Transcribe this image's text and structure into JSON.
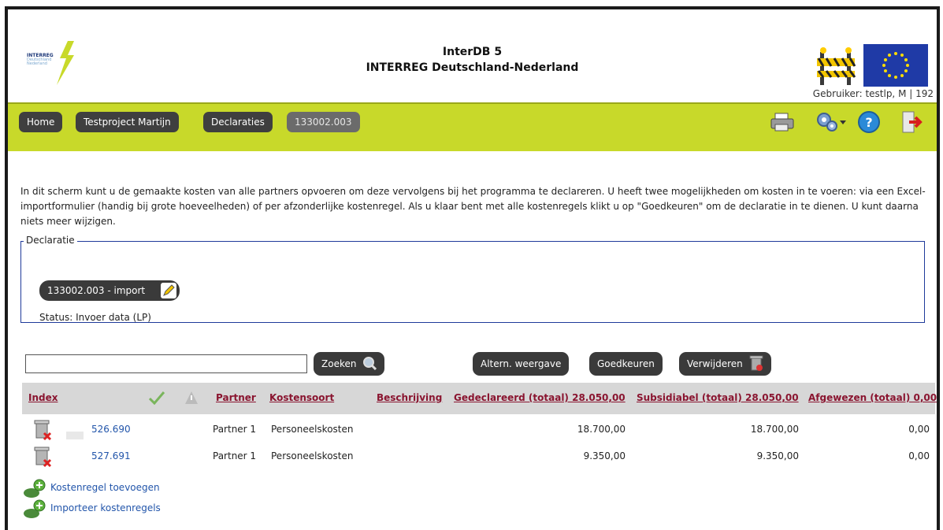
{
  "header": {
    "logo_text": "INTERREG",
    "logo_sub": "Deutschland Nederland",
    "title_line1": "InterDB 5",
    "title_line2": "INTERREG Deutschland-Nederland",
    "user": "Gebruiker: testlp, M | 192"
  },
  "nav": {
    "crumbs": [
      "Home",
      "Testproject Martijn",
      "Declaraties",
      "133002.003"
    ],
    "icons": [
      "print-icon",
      "settings-icon",
      "help-icon",
      "logout-icon"
    ]
  },
  "intro": "In dit scherm kunt u de gemaakte kosten van alle partners opvoeren om deze vervolgens bij het programma te declareren. U heeft twee mogelijkheden om kosten in te voeren: via een Excel-importformulier (handig bij grote hoeveelheden) of per afzonderlijke kostenregel. Als u klaar bent met alle kostenregels klikt u op \"Goedkeuren\" om de declaratie in te dienen. U kunt daarna niets meer wijzigen.",
  "declaratie": {
    "legend": "Declaratie",
    "pill": "133002.003 - import",
    "status": "Status:  Invoer data (LP)"
  },
  "toolbar": {
    "search_value": "",
    "search_label": "Zoeken",
    "altern_label": "Altern. weergave",
    "approve_label": "Goedkeuren",
    "delete_label": "Verwijderen"
  },
  "table": {
    "headers": {
      "index": "Index",
      "partner": "Partner",
      "kostensoort": "Kostensoort",
      "beschrijving": "Beschrijving",
      "gedeclareerd": "Gedeclareerd (totaal) 28.050,00",
      "subsidiabel": "Subsidiabel (totaal) 28.050,00",
      "afgewezen": "Afgewezen (totaal) 0,00"
    },
    "rows": [
      {
        "index": "526.690",
        "partner": "Partner 1",
        "kostensoort": "Personeelskosten",
        "beschrijving": "",
        "gedeclareerd": "18.700,00",
        "subsidiabel": "18.700,00",
        "afgewezen": "0,00"
      },
      {
        "index": "527.691",
        "partner": "Partner 1",
        "kostensoort": "Personeelskosten",
        "beschrijving": "",
        "gedeclareerd": "9.350,00",
        "subsidiabel": "9.350,00",
        "afgewezen": "0,00"
      }
    ]
  },
  "actions": {
    "add": "Kostenregel toevoegen",
    "import": "Importeer kostenregels"
  },
  "colors": {
    "nav_bg": "#c8d92a",
    "pill_bg": "#3a3a3a",
    "header_link": "#8a1530",
    "link": "#2255aa",
    "table_head_bg": "#d7d7d7"
  }
}
